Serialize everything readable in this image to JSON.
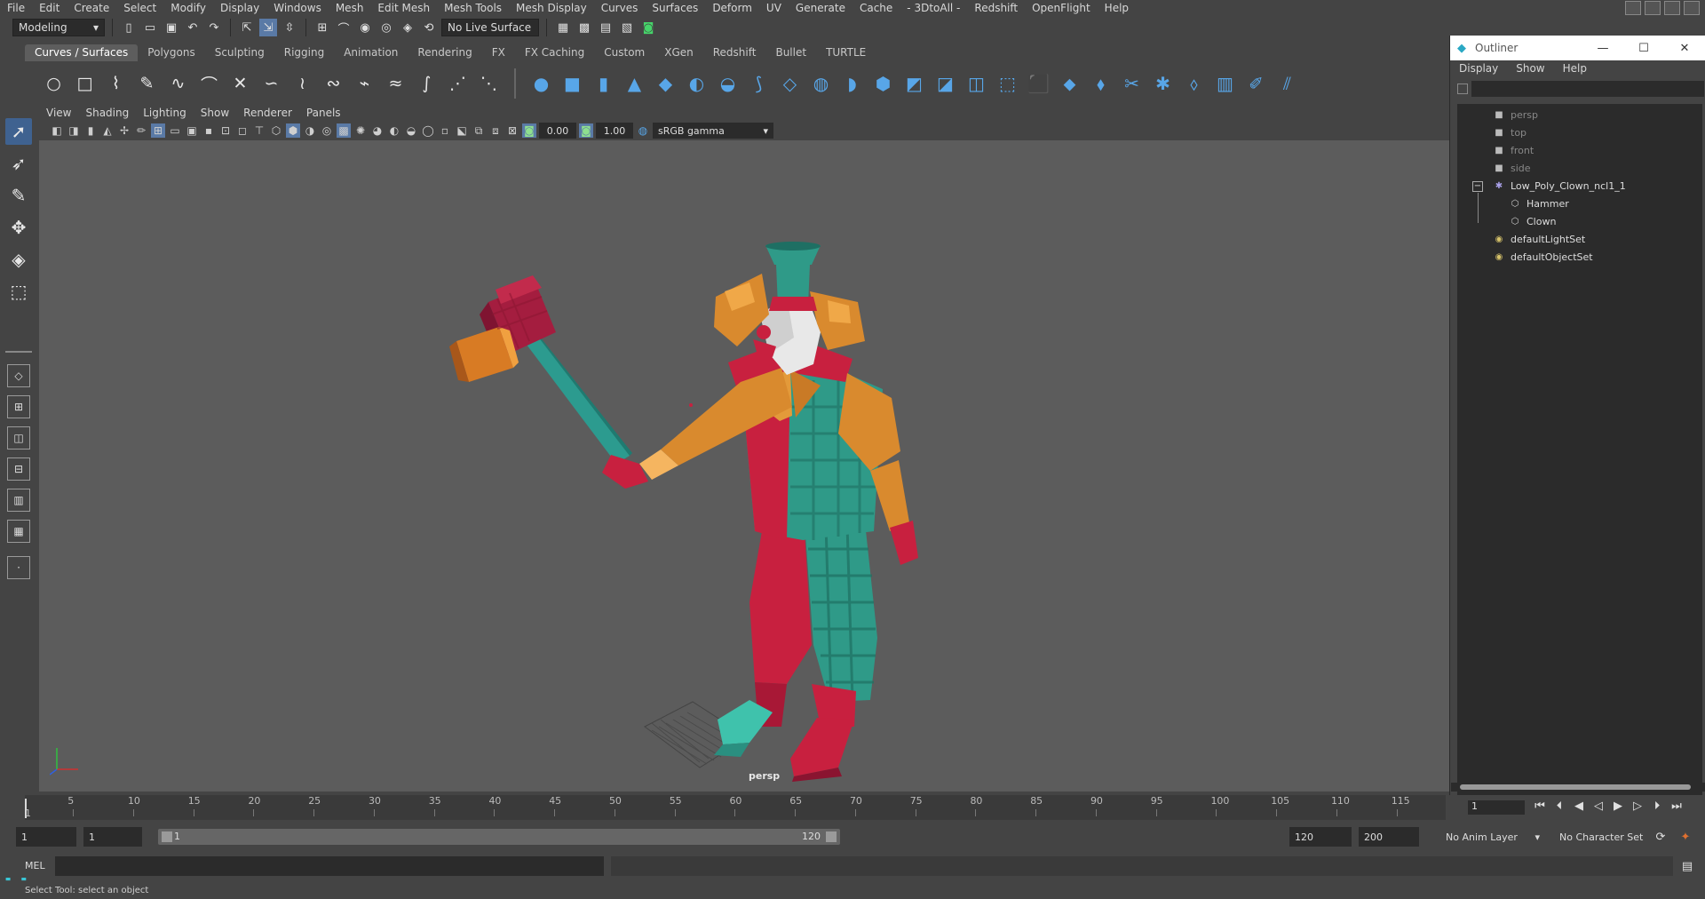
{
  "menubar": {
    "items": [
      "File",
      "Edit",
      "Create",
      "Select",
      "Modify",
      "Display",
      "Windows",
      "Mesh",
      "Edit Mesh",
      "Mesh Tools",
      "Mesh Display",
      "Curves",
      "Surfaces",
      "Deform",
      "UV",
      "Generate",
      "Cache",
      "- 3DtoAll -",
      "Redshift",
      "OpenFlight",
      "Help"
    ]
  },
  "statusline": {
    "mode": "Modeling",
    "live_surface": "No Live Surface"
  },
  "shelf": {
    "tabs": [
      "Curves / Surfaces",
      "Polygons",
      "Sculpting",
      "Rigging",
      "Animation",
      "Rendering",
      "FX",
      "FX Caching",
      "Custom",
      "XGen",
      "Redshift",
      "Bullet",
      "TURTLE"
    ],
    "active_tab": "Curves / Surfaces"
  },
  "panel": {
    "menu": [
      "View",
      "Shading",
      "Lighting",
      "Show",
      "Renderer",
      "Panels"
    ],
    "exposure": "0.00",
    "gamma": "1.00",
    "color_space": "sRGB gamma",
    "camera": "persp"
  },
  "outliner": {
    "title": "Outliner",
    "menu": [
      "Display",
      "Show",
      "Help"
    ],
    "items": {
      "persp": "persp",
      "top": "top",
      "front": "front",
      "side": "side",
      "group": "Low_Poly_Clown_ncl1_1",
      "hammer": "Hammer",
      "clown": "Clown",
      "light_set": "defaultLightSet",
      "object_set": "defaultObjectSet"
    }
  },
  "timeline": {
    "ticks": [
      "5",
      "10",
      "15",
      "20",
      "25",
      "30",
      "35",
      "40",
      "45",
      "50",
      "55",
      "60",
      "65",
      "70",
      "75",
      "80",
      "85",
      "90",
      "95",
      "100",
      "105",
      "110",
      "115"
    ],
    "first_label": "1",
    "current_frame": "1"
  },
  "range": {
    "start": "1",
    "playback_start": "1",
    "slider_start": "1",
    "slider_end": "120",
    "playback_end": "120",
    "end": "200",
    "anim_layer": "No Anim Layer",
    "character_set": "No Character Set"
  },
  "cmdline": {
    "label": "MEL"
  },
  "helpline": {
    "text": "Select Tool: select an object"
  },
  "colors": {
    "viewport_bg": "#5c5c5c",
    "accent": "#5a7aa6",
    "shelf_icon_blue": "#58a6e8"
  }
}
